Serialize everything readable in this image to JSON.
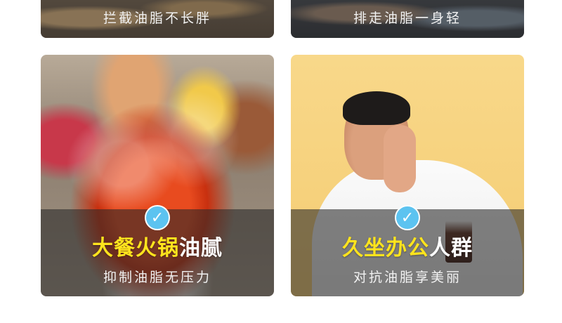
{
  "top_cards": [
    {
      "headline_visible": "",
      "subline": "拦截油脂不长胖"
    },
    {
      "headline_visible": "",
      "subline": "排走油脂一身轻"
    }
  ],
  "cards": [
    {
      "headline_highlight": "大餐火锅",
      "headline_rest": "油腻",
      "subline": "抑制油脂无压力",
      "badge_icon": "check-icon",
      "badge_color": "#5cc3f0"
    },
    {
      "headline_highlight": "久坐办公",
      "headline_rest": "人群",
      "subline": "对抗油脂享美丽",
      "badge_icon": "check-icon",
      "badge_color": "#5cc3f0"
    }
  ],
  "colors": {
    "highlight": "#ffe41d",
    "overlay": "rgba(40,40,40,0.58)",
    "background": "#ffffff"
  }
}
